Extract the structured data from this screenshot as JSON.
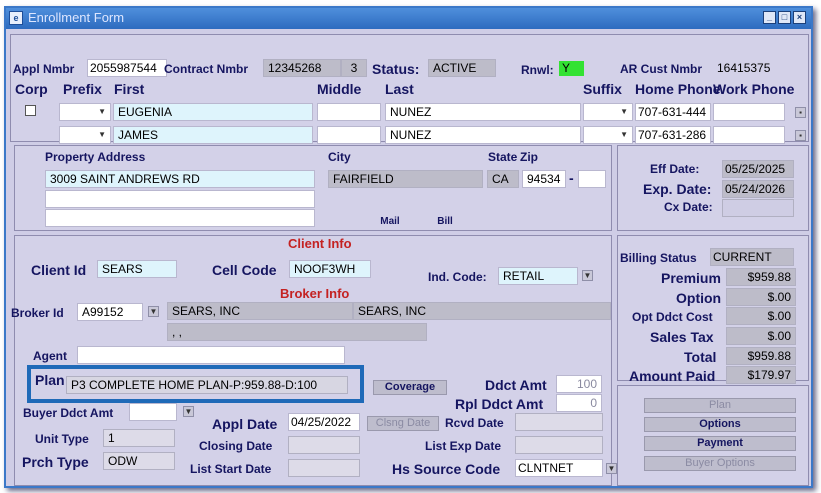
{
  "window": {
    "title": "Enrollment Form",
    "minimize": "_",
    "maximize": "□",
    "close": "×"
  },
  "header": {
    "appl_nmbr_label": "Appl Nmbr",
    "appl_nmbr": "2055987544",
    "contract_nmbr_label": "Contract Nmbr",
    "contract_nmbr": "12345268",
    "contract_seq": "3",
    "status_label": "Status:",
    "status": "ACTIVE",
    "rnwl_label": "Rnwl:",
    "rnwl": "Y",
    "ar_cust_label": "AR Cust Nmbr",
    "ar_cust": "16415375"
  },
  "names": {
    "columns": {
      "corp": "Corp",
      "prefix": "Prefix",
      "first": "First",
      "middle": "Middle",
      "last": "Last",
      "suffix": "Suffix",
      "home_phone": "Home Phone",
      "work_phone": "Work Phone"
    },
    "rows": [
      {
        "first": "EUGENIA",
        "middle": "",
        "last": "NUNEZ",
        "home_phone": "707-631-444",
        "work_phone": ""
      },
      {
        "first": "JAMES",
        "middle": "",
        "last": "NUNEZ",
        "home_phone": "707-631-286",
        "work_phone": ""
      }
    ]
  },
  "address": {
    "property_label": "Property Address",
    "line1": "3009 SAINT ANDREWS RD",
    "city_label": "City",
    "city": "FAIRFIELD",
    "state_label": "State",
    "zip_label": "Zip",
    "state": "CA",
    "zip": "94534",
    "zip_sep": "-",
    "mail_btn": "Mail",
    "bill_btn": "Bill"
  },
  "dates": {
    "eff_label": "Eff Date:",
    "eff": "05/25/2025",
    "exp_label": "Exp. Date:",
    "exp": "05/24/2026",
    "cx_label": "Cx Date:",
    "cx": ""
  },
  "client": {
    "section_label": "Client Info",
    "client_id_label": "Client Id",
    "client_id": "SEARS",
    "cell_code_label": "Cell Code",
    "cell_code": "NOOF3WH",
    "ind_code_label": "Ind. Code:",
    "ind_code": "RETAIL"
  },
  "broker": {
    "section_label": "Broker Info",
    "broker_id_label": "Broker Id",
    "broker_id": "A99152",
    "name1": "SEARS, INC",
    "name2": "SEARS, INC",
    "addr": ", ,"
  },
  "plan": {
    "agent_label": "Agent",
    "plan_label": "Plan",
    "plan_value": "P3 COMPLETE HOME PLAN-P:959.88-D:100",
    "coverage_btn": "Coverage",
    "ddct_amt_label": "Ddct Amt",
    "ddct_amt": "100",
    "rpl_ddct_label": "Rpl Ddct Amt",
    "rpl_ddct": "0",
    "buyer_ddct_label": "Buyer Ddct Amt",
    "appl_date_label": "Appl Date",
    "appl_date": "04/25/2022",
    "clsng_btn": "Clsng Date",
    "rcvd_date_label": "Rcvd Date",
    "unit_type_label": "Unit Type",
    "unit_type": "1",
    "closing_date_label": "Closing Date",
    "list_exp_label": "List Exp Date",
    "prch_type_label": "Prch Type",
    "prch_type": "ODW",
    "list_start_label": "List Start Date",
    "hs_source_label": "Hs Source Code",
    "hs_source": "CLNTNET"
  },
  "billing": {
    "status_label": "Billing Status",
    "status": "CURRENT",
    "premium_label": "Premium",
    "premium": "$959.88",
    "option_label": "Option",
    "option": "$.00",
    "opt_ddct_label": "Opt Ddct Cost",
    "opt_ddct": "$.00",
    "sales_tax_label": "Sales Tax",
    "sales_tax": "$.00",
    "total_label": "Total",
    "total": "$959.88",
    "amount_paid_label": "Amount Paid",
    "amount_paid": "$179.97"
  },
  "actions": {
    "plan": "Plan",
    "options": "Options",
    "payment": "Payment",
    "buyer_options": "Buyer Options"
  },
  "colors": {
    "titlebar": "#2d6bbf",
    "highlight": "#1f6ab8",
    "rnwl_flag": "#33e233"
  }
}
